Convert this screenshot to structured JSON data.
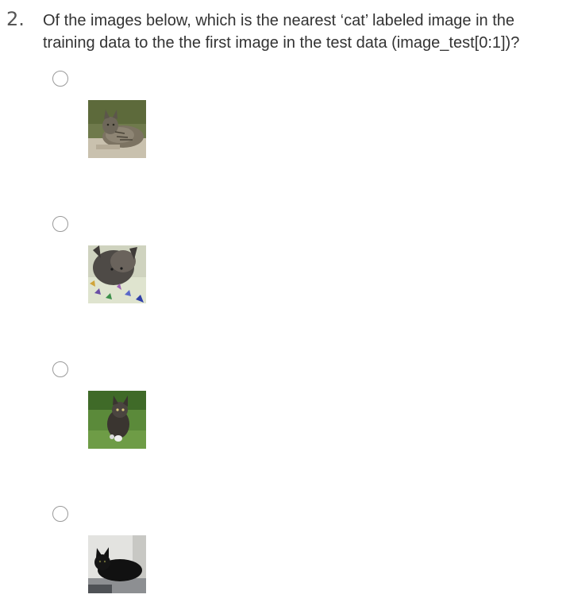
{
  "question": {
    "number": "2.",
    "text": "Of the images below, which is the nearest ‘cat’ labeled image in the training data to the the first image in the test data (image_test[0:1])?"
  },
  "options": [
    {
      "image": "tabby-cat-on-pavement-thumbnail",
      "selected": false
    },
    {
      "image": "gray-cat-on-floral-blanket-thumbnail",
      "selected": false
    },
    {
      "image": "kitten-on-grass-thumbnail",
      "selected": false
    },
    {
      "image": "black-cat-lying-thumbnail",
      "selected": false
    }
  ]
}
